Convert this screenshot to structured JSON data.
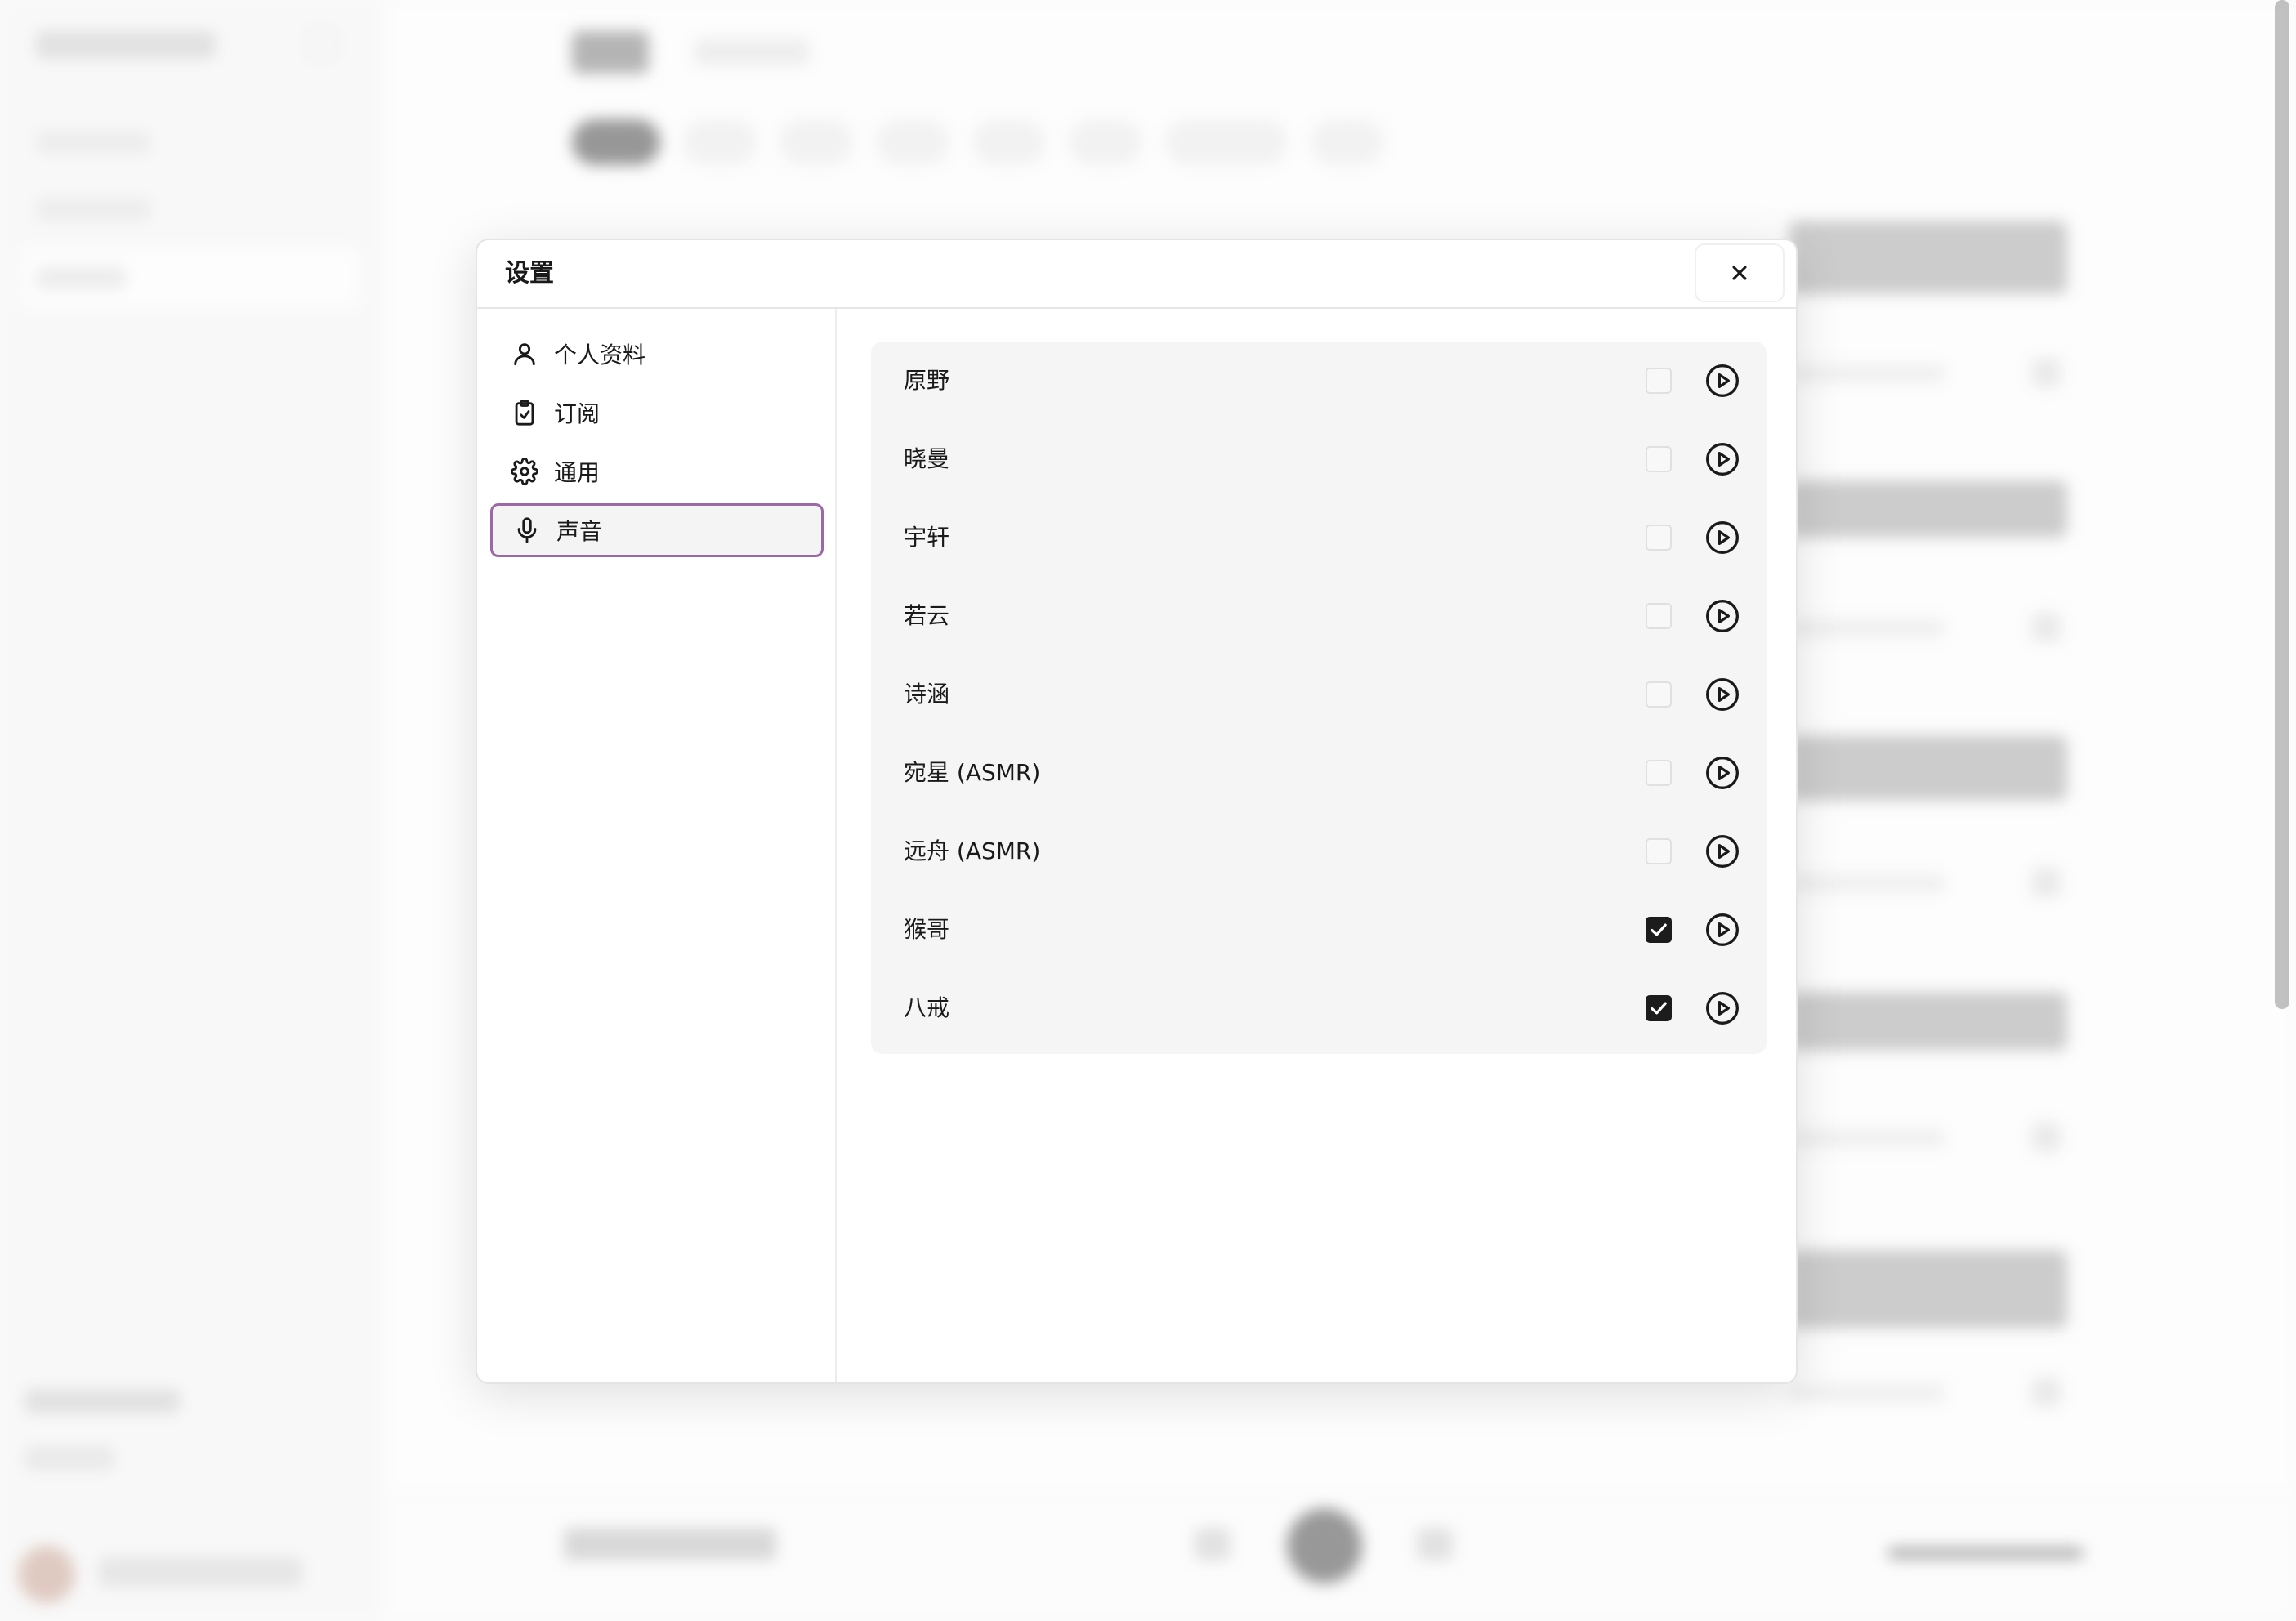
{
  "dialog": {
    "title": "设置",
    "close_icon": "close-icon"
  },
  "settings_nav": [
    {
      "label": "个人资料",
      "icon": "user-icon",
      "active": false
    },
    {
      "label": "订阅",
      "icon": "clipboard-check-icon",
      "active": false
    },
    {
      "label": "通用",
      "icon": "gear-icon",
      "active": false
    },
    {
      "label": "声音",
      "icon": "microphone-icon",
      "active": true
    }
  ],
  "voices": [
    {
      "name": "原野",
      "checked": false
    },
    {
      "name": "晓曼",
      "checked": false
    },
    {
      "name": "宇轩",
      "checked": false
    },
    {
      "name": "若云",
      "checked": false
    },
    {
      "name": "诗涵",
      "checked": false
    },
    {
      "name": "宛星 (ASMR)",
      "checked": false
    },
    {
      "name": "远舟 (ASMR)",
      "checked": false
    },
    {
      "name": "猴哥",
      "checked": true
    },
    {
      "name": "八戒",
      "checked": true
    }
  ],
  "colors": {
    "active_border": "#9b6aa6",
    "panel_bg": "#f5f5f5",
    "checked_bg": "#1c1c1c"
  }
}
